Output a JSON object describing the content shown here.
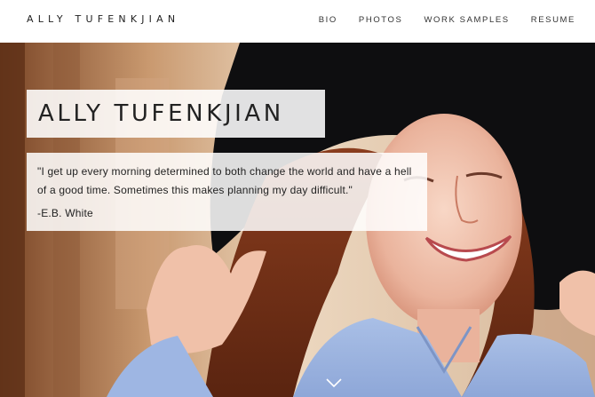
{
  "header": {
    "brand": "ALLY TUFENKJIAN",
    "nav": [
      "BIO",
      "PHOTOS",
      "WORK SAMPLES",
      "RESUME"
    ]
  },
  "hero": {
    "title": "ALLY TUFENKJIAN",
    "quote": "\"I get up every morning determined to both change the world and have a hell of a good time. Sometimes this makes planning my day difficult.\"",
    "author": "-E.B. White",
    "scroll_icon": "chevron-down-icon"
  },
  "colors": {
    "topbar_bg": "#ffffff",
    "text": "#222222",
    "box_bg": "#ffffff"
  }
}
